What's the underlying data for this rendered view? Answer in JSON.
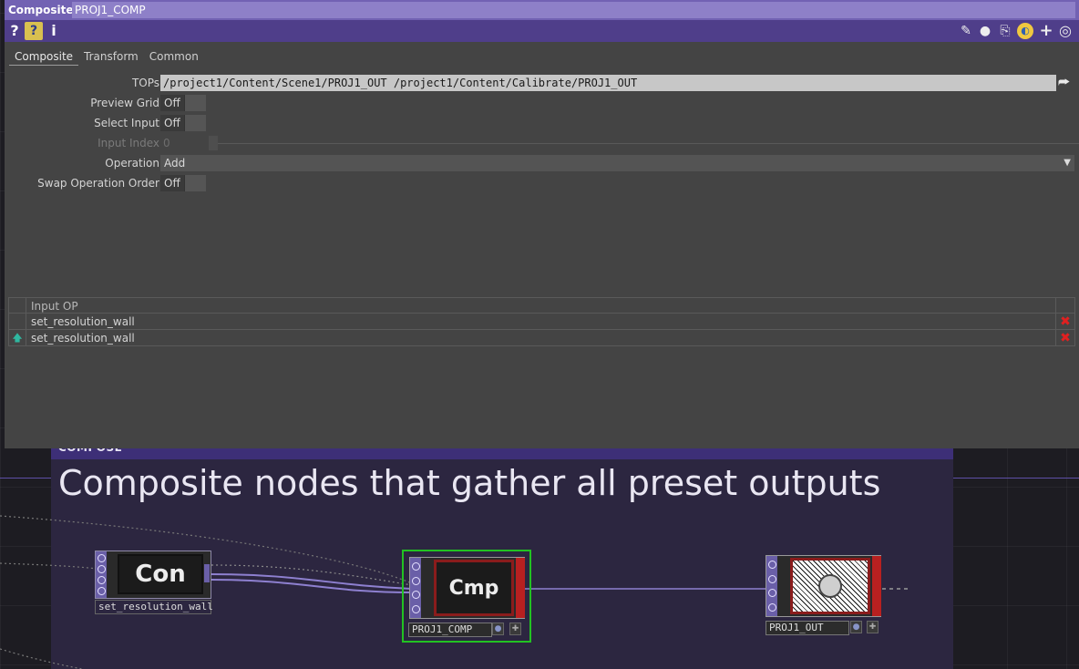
{
  "dialog": {
    "type_label": "Composite",
    "op_name": "PROJ1_COMP",
    "toolbar": {
      "help_icon": "?",
      "python_help_icon": "?",
      "info_icon": "i",
      "right_icons": [
        "pencil-icon",
        "comment-icon",
        "clone-icon",
        "python-icon",
        "plus-icon",
        "target-icon"
      ]
    },
    "tabs": [
      {
        "label": "Composite",
        "active": true
      },
      {
        "label": "Transform",
        "active": false
      },
      {
        "label": "Common",
        "active": false
      }
    ],
    "params": {
      "tops": {
        "label": "TOPs",
        "value": "/project1/Content/Scene1/PROJ1_OUT /project1/Content/Calibrate/PROJ1_OUT"
      },
      "preview_grid": {
        "label": "Preview Grid",
        "value": "Off"
      },
      "select_input": {
        "label": "Select Input",
        "value": "Off"
      },
      "input_index": {
        "label": "Input Index",
        "value": "0"
      },
      "operation": {
        "label": "Operation",
        "value": "Add"
      },
      "swap_op_order": {
        "label": "Swap Operation Order",
        "value": "Off"
      }
    },
    "sequence": {
      "header": "Input OP",
      "rows": [
        {
          "value": "set_resolution_wall",
          "delete": "✖"
        },
        {
          "value": "set_resolution_wall",
          "delete": "✖"
        }
      ]
    }
  },
  "network": {
    "annotation": {
      "header": "COMPOSE",
      "title": "Composite nodes that gather all preset outputs"
    },
    "nodes": [
      {
        "id": "con",
        "viewer_text": "Con",
        "name": "set_resolution_wall"
      },
      {
        "id": "cmp",
        "viewer_text": "Cmp",
        "name": "PROJ1_COMP"
      },
      {
        "id": "out",
        "viewer_text": "",
        "name": "PROJ1_OUT"
      }
    ]
  },
  "colors": {
    "titlebar": "#7262b3",
    "toolbar": "#4f3e8a",
    "panel": "#444444",
    "annotate_header": "#3d2f77",
    "selected_node_border": "#22c222",
    "node_flag_red": "#b82020",
    "delete_red": "#e02020"
  }
}
